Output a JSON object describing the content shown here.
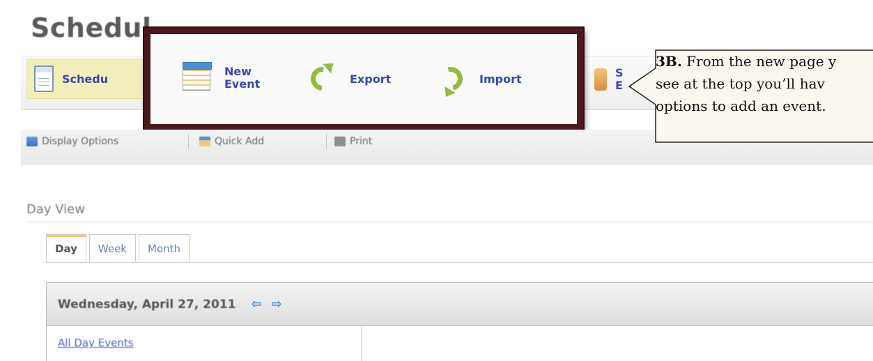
{
  "page": {
    "title": "Schedul"
  },
  "toolbar": {
    "schedule_label": "Schedu",
    "new_event_line1": "New",
    "new_event_line2": "Event",
    "export_label": "Export",
    "import_label": "Import",
    "partial_line1": "S",
    "partial_line2": "E"
  },
  "subbar": {
    "display_options": "Display Options",
    "quick_add": "Quick Add",
    "print": "Print"
  },
  "section": {
    "title": "Day View"
  },
  "tabs": [
    "Day",
    "Week",
    "Month"
  ],
  "calendar": {
    "date": "Wednesday, April 27, 2011",
    "all_day_events": "All Day Events"
  },
  "callout": {
    "step": "3B.",
    "line1_rest": " From the new page y",
    "line2": "see at the top you’ll hav",
    "line3": "options to add an event."
  },
  "colors": {
    "link": "#3a46b5",
    "frame": "#4a1a1e",
    "highlight": "#f2eebc",
    "icon_green": "#8fbd3c"
  }
}
